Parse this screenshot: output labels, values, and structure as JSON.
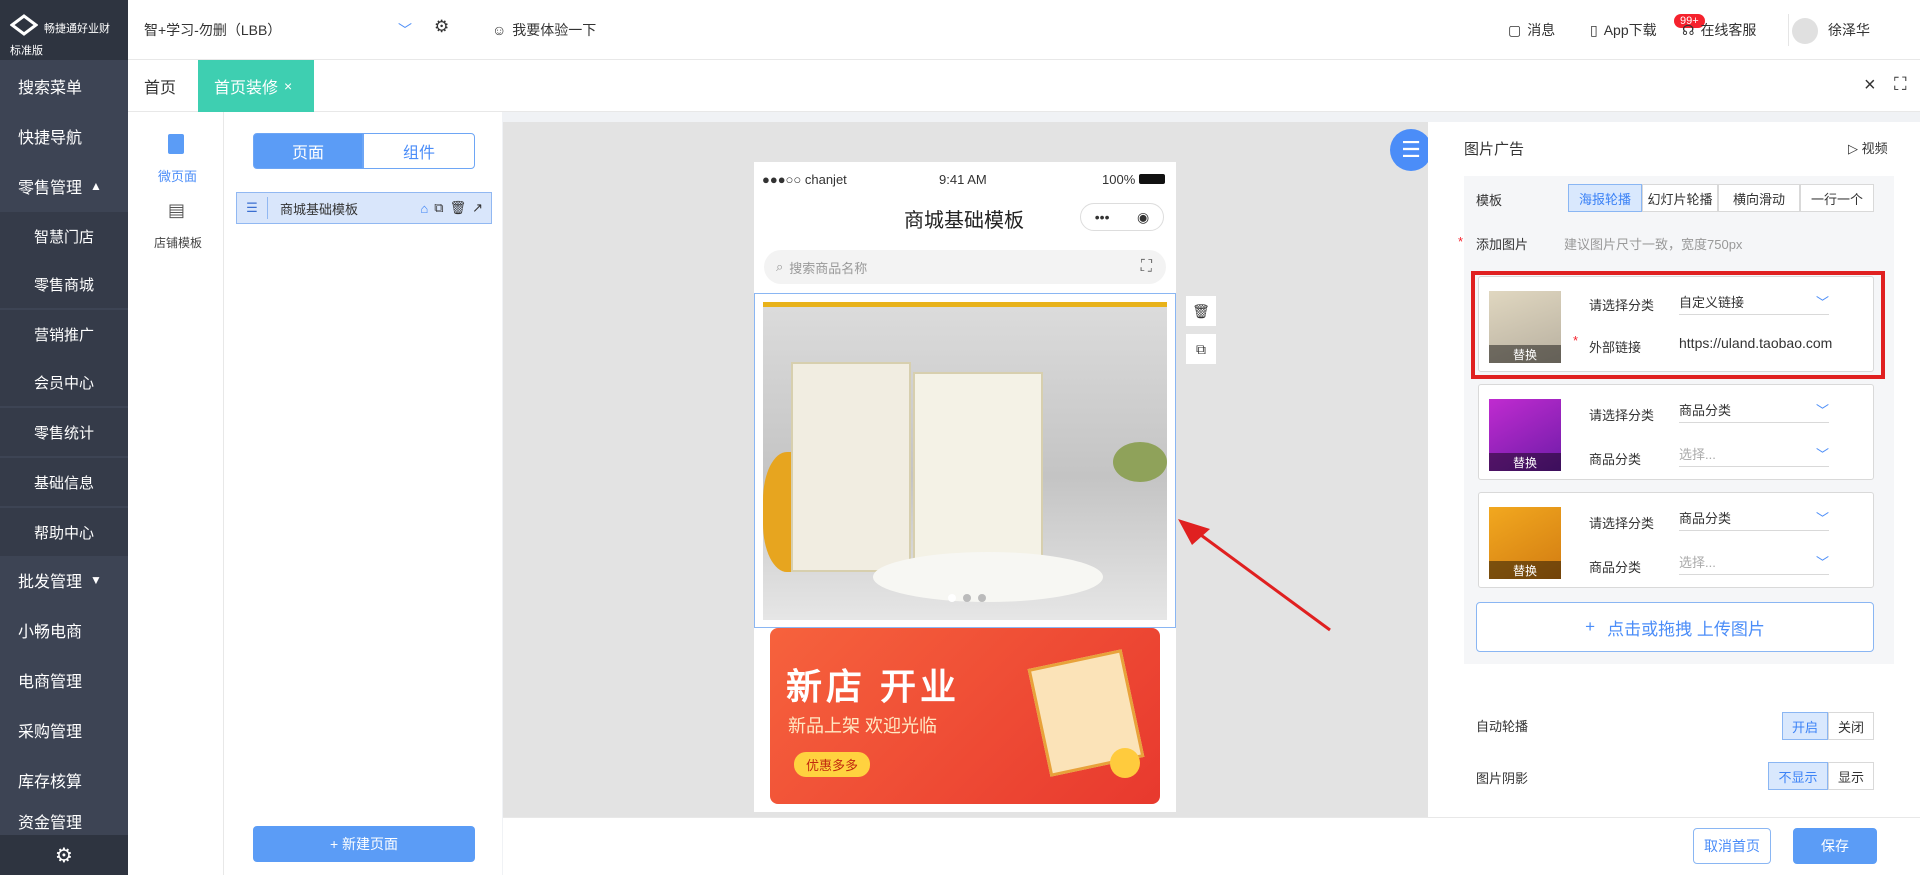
{
  "sidebar": {
    "logo_text": "畅捷通好业财",
    "logo_sub": "标准版",
    "items": [
      {
        "label": "搜索菜单"
      },
      {
        "label": "快捷导航"
      },
      {
        "label": "零售管理"
      },
      {
        "label": "智慧门店"
      },
      {
        "label": "零售商城"
      },
      {
        "label": "营销推广"
      },
      {
        "label": "会员中心"
      },
      {
        "label": "零售统计"
      },
      {
        "label": "基础信息"
      },
      {
        "label": "帮助中心"
      },
      {
        "label": "批发管理"
      },
      {
        "label": "小畅电商"
      },
      {
        "label": "电商管理"
      },
      {
        "label": "采购管理"
      },
      {
        "label": "库存核算"
      },
      {
        "label": "资金管理"
      }
    ]
  },
  "topbar": {
    "company": "智+学习-勿删（LBB）",
    "try_label": "我要体验一下",
    "messages_label": "消息",
    "messages_badge": "99+",
    "app_label": "App下载",
    "service_label": "在线客服",
    "user_name": "徐泽华"
  },
  "tabs": [
    {
      "label": "首页"
    },
    {
      "label": "首页装修"
    }
  ],
  "left": {
    "micro_page": "微页面",
    "store_template": "店铺模板",
    "seg_page": "页面",
    "seg_component": "组件",
    "template_name": "商城基础模板",
    "new_page": "+ 新建页面"
  },
  "phone": {
    "carrier": "●●●○○ chanjet",
    "time": "9:41 AM",
    "battery": "100%",
    "title": "商城基础模板",
    "search_placeholder": "搜索商品名称",
    "banner_title": "新店 开业",
    "banner_sub": "新品上架 欢迎光临",
    "banner_tag": "优惠多多"
  },
  "right": {
    "section_title": "图片广告",
    "video_label": "视频",
    "template_label": "模板",
    "template_options": [
      "海报轮播",
      "幻灯片轮播",
      "横向滑动",
      "一行一个"
    ],
    "add_image_label": "添加图片",
    "add_image_hint": "建议图片尺寸一致，宽度750px",
    "cards": [
      {
        "cat_label": "请选择分类",
        "cat_value": "自定义链接",
        "field_label": "外部链接",
        "field_value": "https://uland.taobao.com",
        "replace": "替换"
      },
      {
        "cat_label": "请选择分类",
        "cat_value": "商品分类",
        "field_label": "商品分类",
        "field_value": "选择...",
        "replace": "替换"
      },
      {
        "cat_label": "请选择分类",
        "cat_value": "商品分类",
        "field_label": "商品分类",
        "field_value": "选择...",
        "replace": "替换"
      }
    ],
    "upload_label": "点击或拖拽 上传图片",
    "autoplay_label": "自动轮播",
    "autoplay_on": "开启",
    "autoplay_off": "关闭",
    "shadow_label": "图片阴影",
    "shadow_hide": "不显示",
    "shadow_show": "显示"
  },
  "footer": {
    "cancel_home": "取消首页",
    "save": "保存"
  },
  "colors": {
    "sidebar_bg": "#3d4454",
    "accent": "#5b9cf6",
    "active_tab": "#3ecfb1",
    "highlight_box": "#e02020"
  }
}
